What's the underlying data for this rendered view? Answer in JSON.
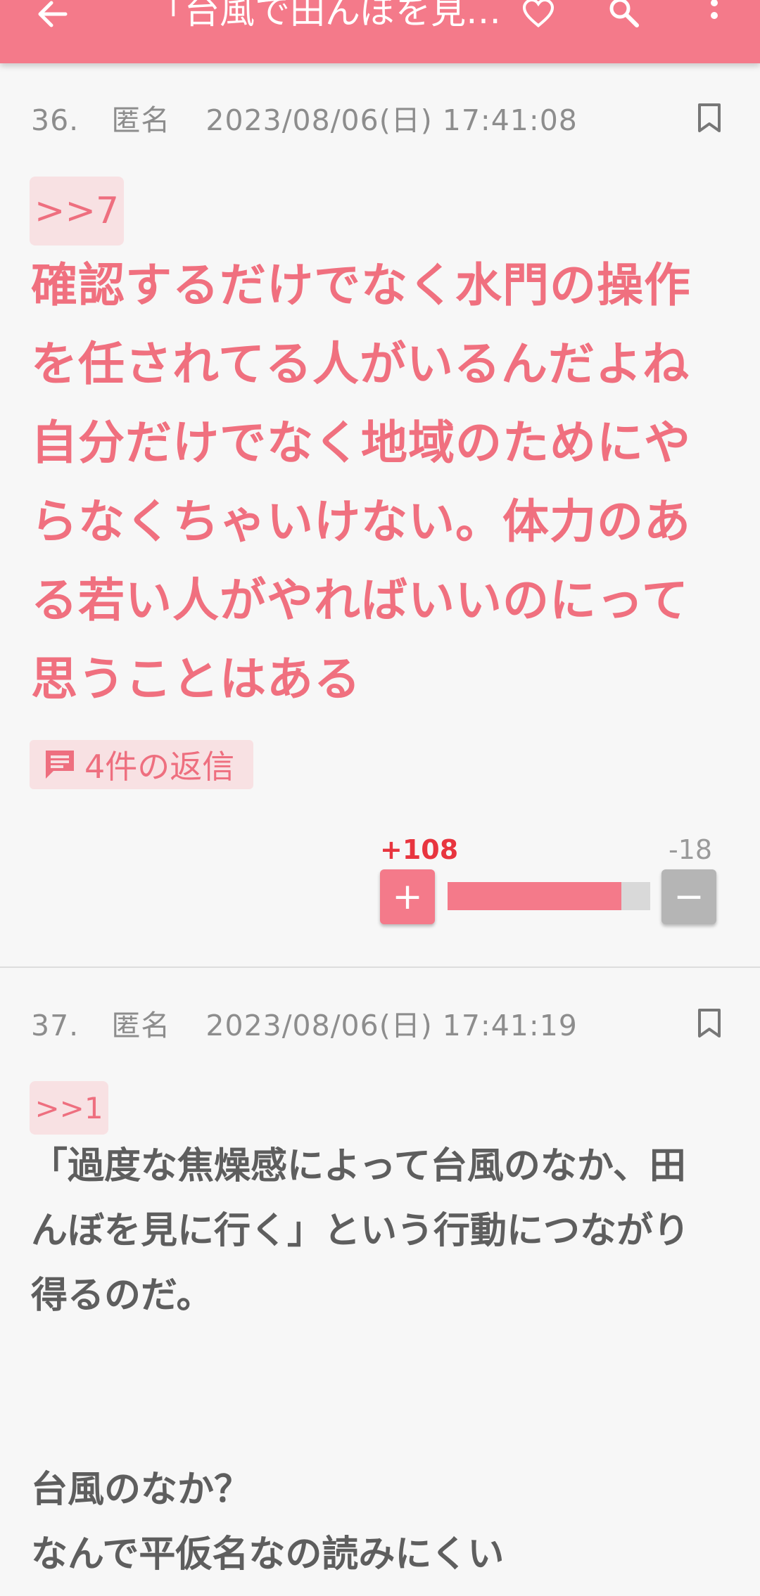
{
  "appbar": {
    "title": "「台風で田んぼを見…",
    "icons": [
      "back-arrow-icon",
      "heart-icon",
      "search-icon",
      "more-vert-icon"
    ]
  },
  "comments": [
    {
      "number": "36.",
      "author": "匿名",
      "datetime": "2023/08/06(日) 17:41:08",
      "anchor": ">>7",
      "lines": [
        "確認するだけでなく水門の操作",
        "を任されてる人がいるんだよね",
        "自分だけでなく地域のためにや",
        "らなくちゃいけない。体力のあ",
        "る若い人がやればいいのにって",
        "思うことはある"
      ],
      "replies_label": "4件の返信",
      "votes": {
        "plus": "+108",
        "minus": "-18",
        "plus_symbol": "+",
        "minus_symbol": "−",
        "ratio": 0.857
      }
    },
    {
      "number": "37.",
      "author": "匿名",
      "datetime": "2023/08/06(日) 17:41:19",
      "anchor": ">>1",
      "lines": [
        "「過度な焦燥感によって台風のなか、田",
        "んぼを見に行く」という行動につながり",
        "得るのだ。",
        "",
        "",
        "台風のなか？",
        "なんで平仮名なの読みにくい"
      ]
    }
  ],
  "colors": {
    "accent": "#f47a8a",
    "pink_text": "#f0707f",
    "chip_bg": "#f8e1e3",
    "plus_count": "#e8353f"
  }
}
